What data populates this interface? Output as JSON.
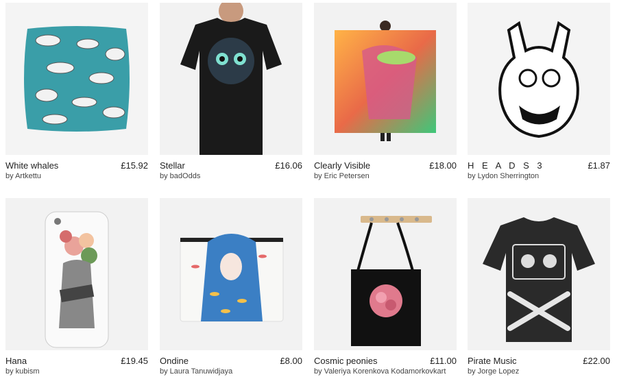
{
  "products": [
    {
      "title": "White whales",
      "artist": "by Artkettu",
      "price": "£15.92",
      "type": "pillow",
      "color": "#3a9ea8"
    },
    {
      "title": "Stellar",
      "artist": "by badOdds",
      "price": "£16.06",
      "type": "tshirt",
      "color": "#1a1a1a"
    },
    {
      "title": "Clearly Visible",
      "artist": "by Eric Petersen",
      "price": "£18.00",
      "type": "scarf",
      "color": "#e96a48"
    },
    {
      "title": "H E A D S 3",
      "artist": "by Lydon Sherrington",
      "price": "£1.87",
      "type": "sticker",
      "color": "#111111"
    },
    {
      "title": "Hana",
      "artist": "by kubism",
      "price": "£19.45",
      "type": "phone-case",
      "color": "#e9a39a"
    },
    {
      "title": "Ondine",
      "artist": "by Laura Tanuwidjaya",
      "price": "£8.00",
      "type": "pouch",
      "color": "#3b7fc4"
    },
    {
      "title": "Cosmic peonies",
      "artist": "by Valeriya Korenkova Kodamorkovkart",
      "price": "£11.00",
      "type": "tote-bag",
      "color": "#e07a8d"
    },
    {
      "title": "Pirate Music",
      "artist": "by Jorge Lopez",
      "price": "£22.00",
      "type": "tshirt",
      "color": "#2a2a2a"
    }
  ]
}
